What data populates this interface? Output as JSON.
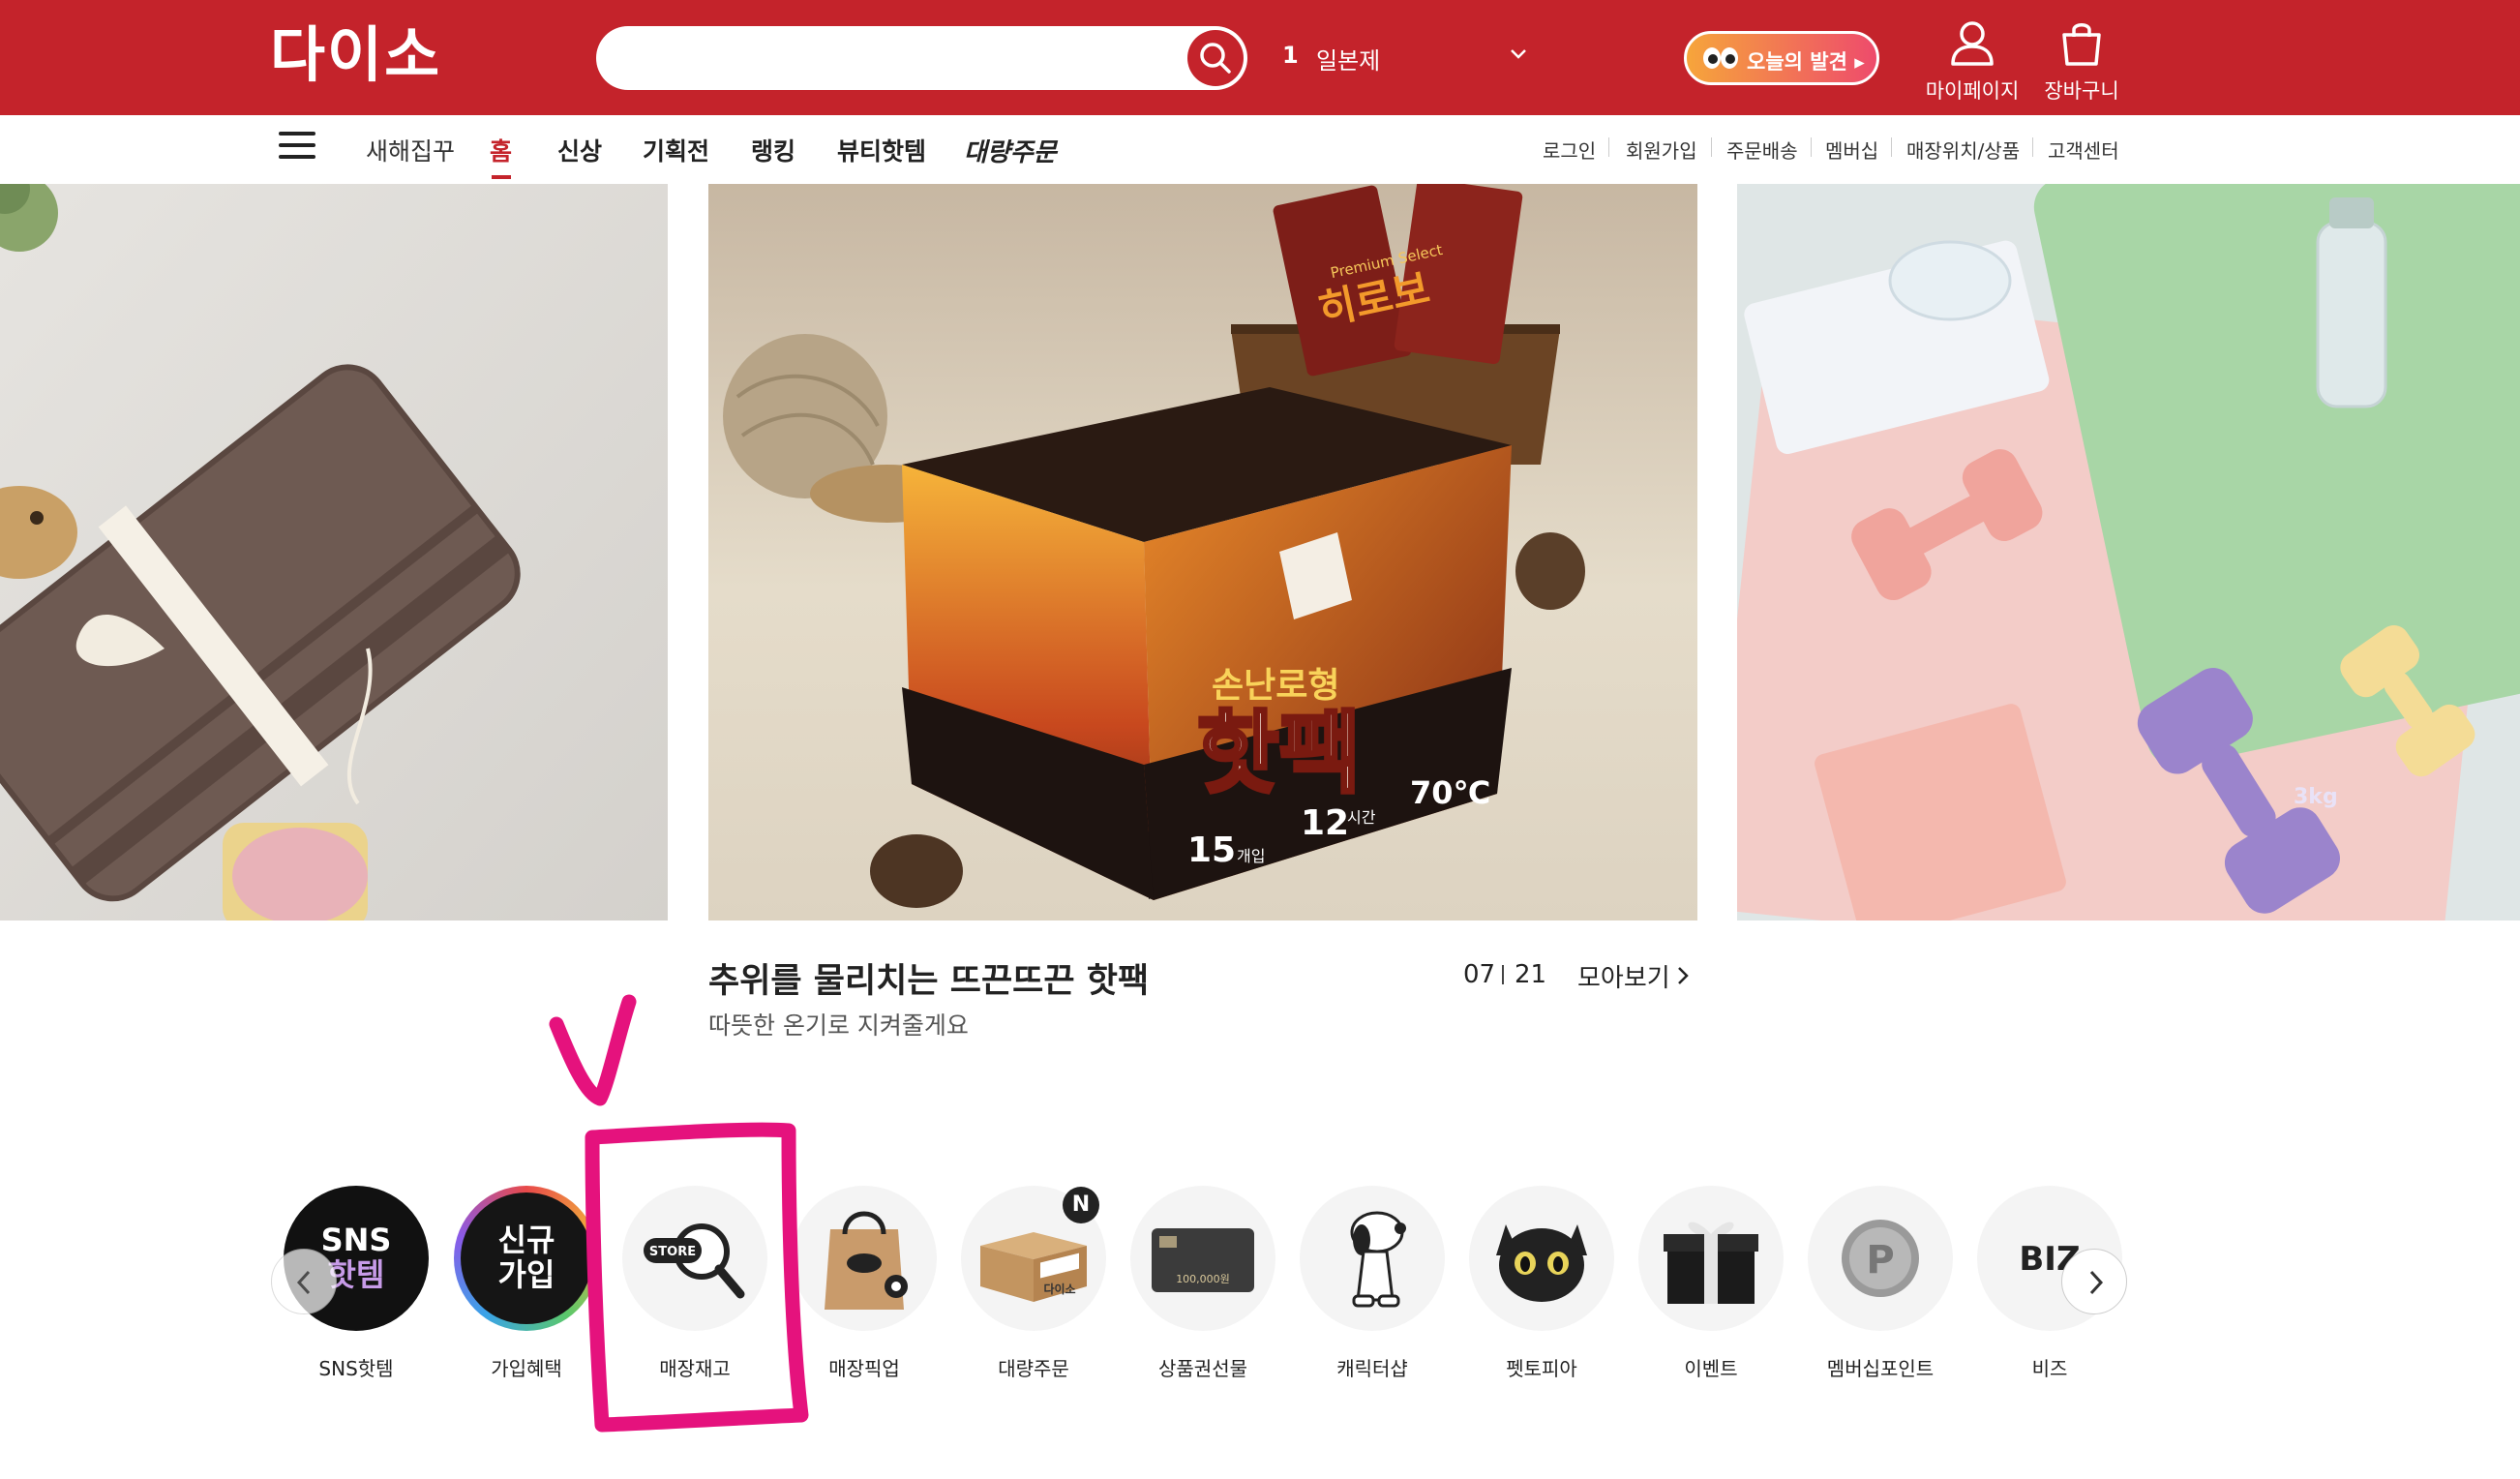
{
  "header": {
    "logo": "다이소",
    "search_placeholder": "",
    "keyword_rank": "1",
    "keyword_text": "일본제",
    "discover_label": "오늘의 발견 ▸",
    "mypage_label": "마이페이지",
    "cart_label": "장바구니"
  },
  "nav": {
    "items": [
      {
        "label": "새해집꾸"
      },
      {
        "label": "홈"
      },
      {
        "label": "신상"
      },
      {
        "label": "기획전"
      },
      {
        "label": "랭킹"
      },
      {
        "label": "뷰티핫템"
      },
      {
        "label": "대량주문"
      }
    ],
    "util": [
      "로그인",
      "회원가입",
      "주문배송",
      "멤버십",
      "매장위치/상품",
      "고객센터"
    ]
  },
  "banner": {
    "title": "추위를 물리치는 뜨끈뜨끈 핫팩",
    "subtitle": "따뜻한 온기로 지켜줄게요",
    "page_current": "07",
    "page_total": "21",
    "view_all": "모아보기",
    "product_texts": {
      "box_brand": "손난로형",
      "box_title": "핫팩",
      "box_count": "15",
      "box_count_unit": "개입",
      "box_hours": "12",
      "box_hours_unit": "시간",
      "box_temp": "70℃",
      "packet_text": "Premium Select",
      "packet_name": "히로보",
      "dumbbell_weight": "3kg"
    }
  },
  "quick_menu": {
    "items": [
      {
        "label": "SNS핫템",
        "icon_text": "SNS\n핫템"
      },
      {
        "label": "가입혜택",
        "icon_text": "신규\n가입"
      },
      {
        "label": "매장재고",
        "icon_text": "STORE"
      },
      {
        "label": "매장픽업",
        "icon_text": ""
      },
      {
        "label": "대량주문",
        "icon_text": "다이소",
        "badge": "N"
      },
      {
        "label": "상품권선물",
        "icon_text": "100,000원"
      },
      {
        "label": "캐릭터샵",
        "icon_text": ""
      },
      {
        "label": "펫토피아",
        "icon_text": ""
      },
      {
        "label": "이벤트",
        "icon_text": ""
      },
      {
        "label": "멤버십포인트",
        "icon_text": "P"
      },
      {
        "label": "비즈",
        "icon_text": "BIZ"
      }
    ]
  },
  "colors": {
    "brand_red": "#c4232b",
    "annotation_pink": "#e5127d"
  }
}
